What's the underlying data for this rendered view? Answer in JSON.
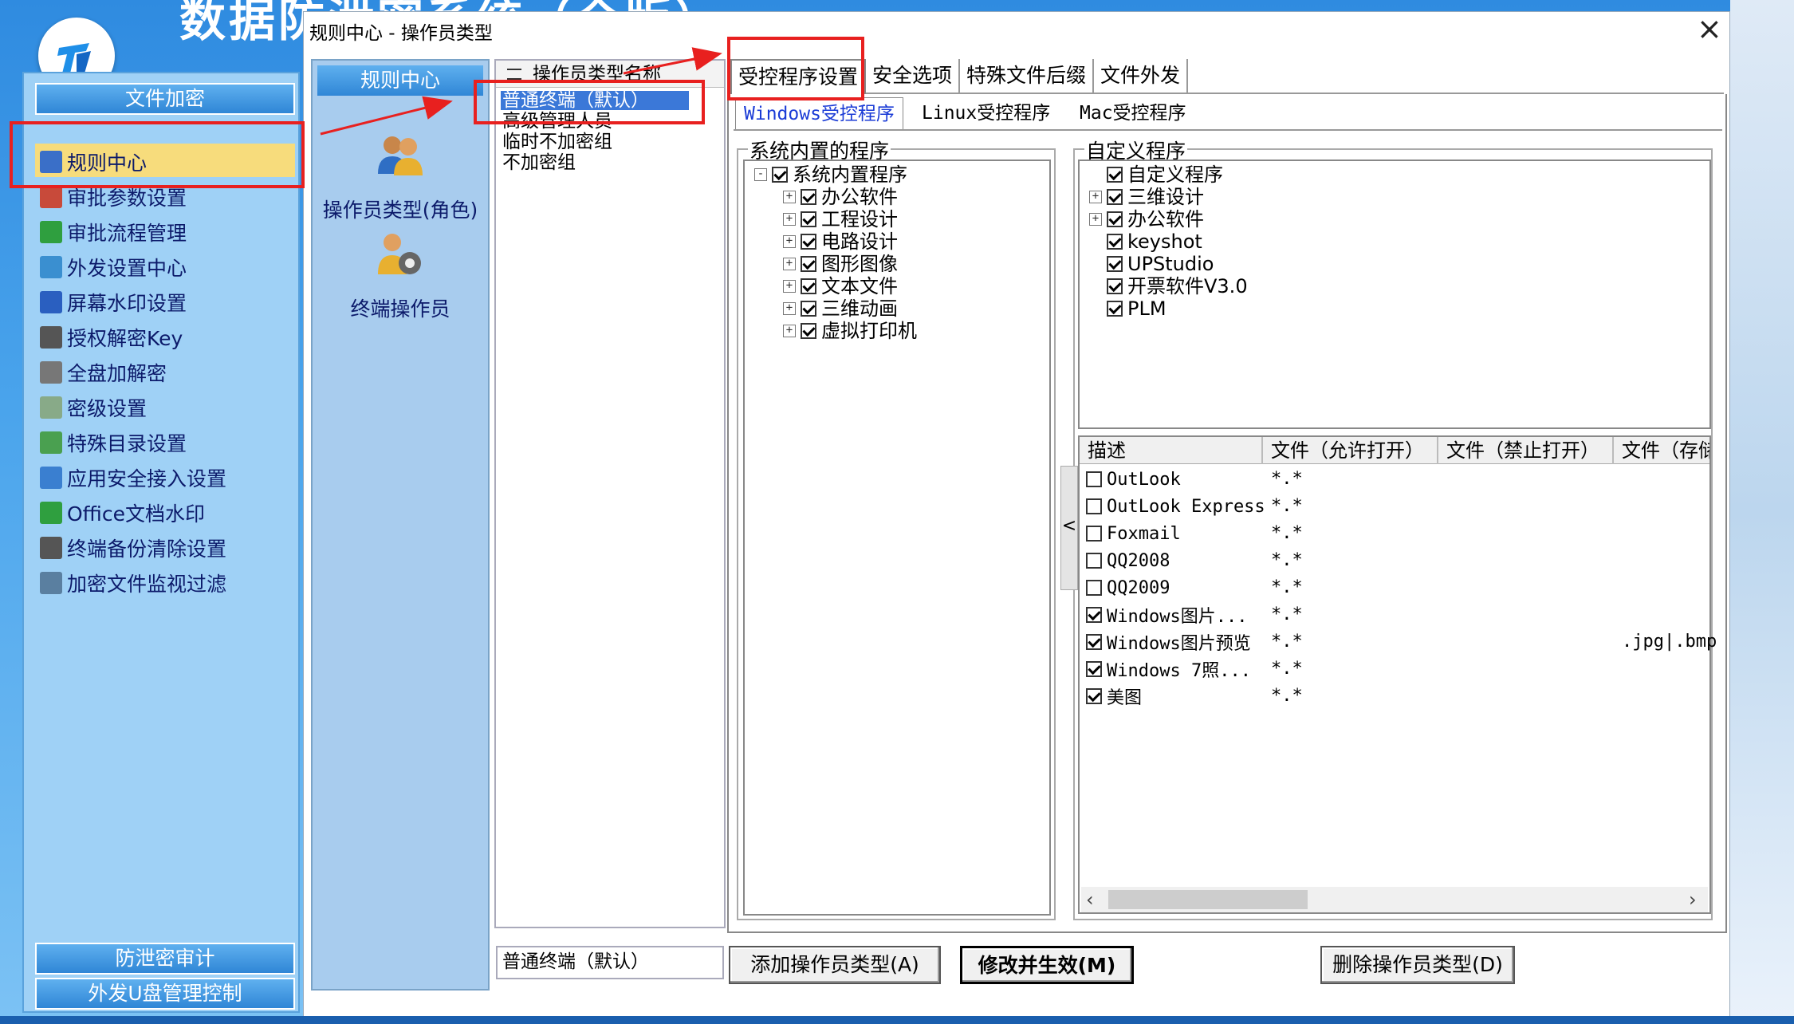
{
  "background": {
    "title": "数据防泄密系统（全版）"
  },
  "sidebar": {
    "header": "文件加密",
    "items": [
      {
        "label": "规则中心",
        "icon": "rules-icon"
      },
      {
        "label": "审批参数设置",
        "icon": "approval-params-icon"
      },
      {
        "label": "审批流程管理",
        "icon": "approval-flow-icon"
      },
      {
        "label": "外发设置中心",
        "icon": "outgoing-settings-icon"
      },
      {
        "label": "屏幕水印设置",
        "icon": "monitor-icon"
      },
      {
        "label": "授权解密Key",
        "icon": "lock-icon"
      },
      {
        "label": "全盘加解密",
        "icon": "key-icon"
      },
      {
        "label": "密级设置",
        "icon": "ring-icon"
      },
      {
        "label": "特殊目录设置",
        "icon": "folder-shield-icon"
      },
      {
        "label": "应用安全接入设置",
        "icon": "app-access-icon"
      },
      {
        "label": "Office文档水印",
        "icon": "document-icon"
      },
      {
        "label": "终端备份清除设置",
        "icon": "backup-icon"
      },
      {
        "label": "加密文件监视过滤",
        "icon": "monitor-filter-icon"
      }
    ],
    "footer": [
      "防泄密审计",
      "外发U盘管理控制"
    ]
  },
  "dialog": {
    "title": "规则中心 - 操作员类型",
    "close": "×",
    "rules_panel": {
      "header": "规则中心",
      "items": [
        {
          "label": "操作员类型(角色)",
          "icon": "users-icon"
        },
        {
          "label": "终端操作员",
          "icon": "user-gear-icon"
        }
      ]
    },
    "operator_types": {
      "header": "操作员类型名称",
      "items": [
        "普通终端（默认）",
        "高级管理人员",
        "临时不加密组",
        "不加密组"
      ],
      "current": "普通终端（默认）"
    },
    "tabs": [
      "受控程序设置",
      "安全选项",
      "特殊文件后缀",
      "文件外发"
    ],
    "subtabs": [
      "Windows受控程序",
      "Linux受控程序",
      "Mac受控程序"
    ],
    "builtin": {
      "label": "系统内置的程序",
      "root": "系统内置程序",
      "children": [
        "办公软件",
        "工程设计",
        "电路设计",
        "图形图像",
        "文本文件",
        "三维动画",
        "虚拟打印机"
      ]
    },
    "custom": {
      "label": "自定义程序",
      "root": "自定义程序",
      "children": [
        {
          "label": "三维设计",
          "expandable": "+"
        },
        {
          "label": "办公软件",
          "expandable": "+"
        },
        {
          "label": "keyshot",
          "expandable": ""
        },
        {
          "label": "UPStudio",
          "expandable": ""
        },
        {
          "label": "开票软件V3.0",
          "expandable": ""
        },
        {
          "label": "PLM",
          "expandable": ""
        }
      ]
    },
    "table": {
      "columns": [
        "描述",
        "文件（允许打开）",
        "文件（禁止打开）",
        "文件（存储"
      ],
      "rows": [
        {
          "desc": "OutLook",
          "allow": "*.*",
          "deny": "",
          "store": "",
          "checked": false
        },
        {
          "desc": "OutLook Express",
          "allow": "*.*",
          "deny": "",
          "store": "",
          "checked": false
        },
        {
          "desc": "Foxmail",
          "allow": "*.*",
          "deny": "",
          "store": "",
          "checked": false
        },
        {
          "desc": "QQ2008",
          "allow": "*.*",
          "deny": "",
          "store": "",
          "checked": false
        },
        {
          "desc": "QQ2009",
          "allow": "*.*",
          "deny": "",
          "store": "",
          "checked": false
        },
        {
          "desc": "Windows图片...",
          "allow": "*.*",
          "deny": "",
          "store": "",
          "checked": true
        },
        {
          "desc": "Windows图片预览",
          "allow": "*.*",
          "deny": "",
          "store": ".jpg|.bmp",
          "checked": true
        },
        {
          "desc": "Windows 7照...",
          "allow": "*.*",
          "deny": "",
          "store": "",
          "checked": true
        },
        {
          "desc": "美图",
          "allow": "*.*",
          "deny": "",
          "store": "",
          "checked": true
        }
      ]
    },
    "buttons": {
      "add": "添加操作员类型(A)",
      "modify": "修改并生效(M)",
      "delete": "删除操作员类型(D)"
    },
    "collapse": "<"
  },
  "colors": {
    "annotation": "#e8201f",
    "selection": "#3b78d8",
    "nav_highlight": "#f7dc7c"
  }
}
